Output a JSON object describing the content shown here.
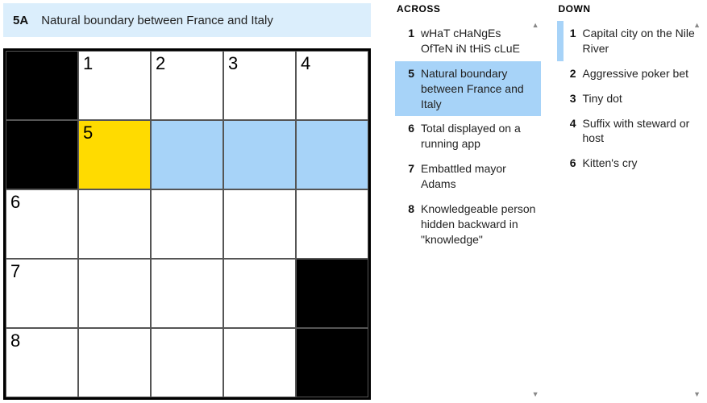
{
  "current_clue": {
    "label": "5A",
    "text": "Natural boundary between France and Italy"
  },
  "grid": [
    [
      {
        "black": true
      },
      {
        "num": "1"
      },
      {
        "num": "2"
      },
      {
        "num": "3"
      },
      {
        "num": "4"
      }
    ],
    [
      {
        "black": true
      },
      {
        "num": "5",
        "state": "yellow"
      },
      {
        "state": "blue"
      },
      {
        "state": "blue"
      },
      {
        "state": "blue"
      }
    ],
    [
      {
        "num": "6"
      },
      {},
      {},
      {},
      {}
    ],
    [
      {
        "num": "7"
      },
      {},
      {},
      {},
      {
        "black": true
      }
    ],
    [
      {
        "num": "8"
      },
      {},
      {},
      {},
      {
        "black": true
      }
    ]
  ],
  "across": {
    "title": "ACROSS",
    "clues": [
      {
        "num": "1",
        "text": "wHaT cHaNgEs OfTeN iN tHiS cLuE"
      },
      {
        "num": "5",
        "text": "Natural boundary between France and Italy",
        "selected": true
      },
      {
        "num": "6",
        "text": "Total displayed on a running app"
      },
      {
        "num": "7",
        "text": "Embattled mayor Adams"
      },
      {
        "num": "8",
        "text": "Knowledgeable person hidden backward in \"knowledge\""
      }
    ]
  },
  "down": {
    "title": "DOWN",
    "clues": [
      {
        "num": "1",
        "text": "Capital city on the Nile River",
        "marked": true
      },
      {
        "num": "2",
        "text": "Aggressive poker bet"
      },
      {
        "num": "3",
        "text": "Tiny dot"
      },
      {
        "num": "4",
        "text": "Suffix with steward or host"
      },
      {
        "num": "6",
        "text": "Kitten's cry"
      }
    ]
  }
}
